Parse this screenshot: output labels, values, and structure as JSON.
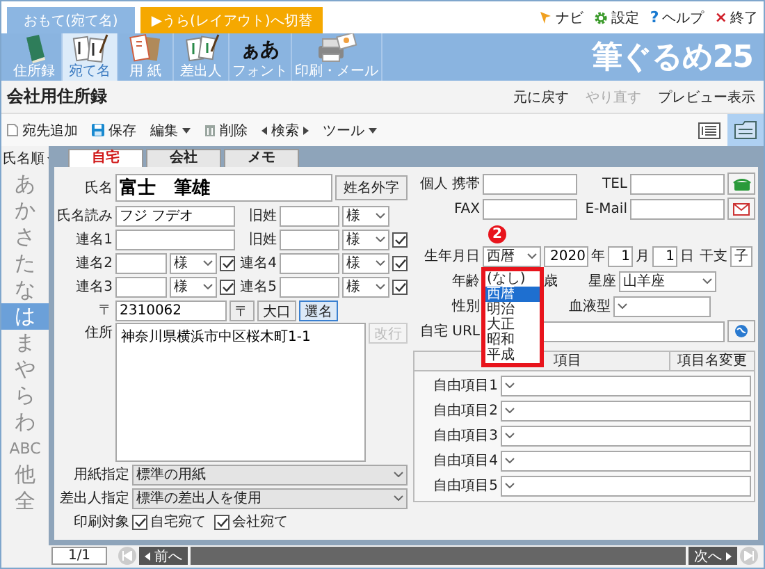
{
  "top_tabs": [
    {
      "label": "おもて(宛て名)",
      "selected": true
    },
    {
      "label": "▶うら(レイアウト)へ切替",
      "selected": false
    }
  ],
  "top_links": [
    {
      "kind": "navi",
      "label": "ナビ"
    },
    {
      "kind": "settings",
      "label": "設定"
    },
    {
      "kind": "help",
      "label": "ヘルプ",
      "glyph": "?"
    },
    {
      "kind": "exit",
      "label": "終了",
      "glyph": "×"
    }
  ],
  "tools": [
    {
      "kind": "book",
      "label": "住所録",
      "selected": false
    },
    {
      "kind": "cards",
      "label": "宛て名",
      "selected": true
    },
    {
      "kind": "paper",
      "label": "用 紙",
      "selected": false
    },
    {
      "kind": "sender",
      "label": "差出人",
      "selected": false
    },
    {
      "kind": "font",
      "label": "フォント",
      "glyph": "ぁあ",
      "selected": false
    },
    {
      "kind": "print",
      "label": "印刷・メール",
      "selected": false
    }
  ],
  "logo": "筆ぐるめ25",
  "title": "会社用住所録",
  "title_actions": [
    {
      "label": "元に戻す",
      "disabled": false
    },
    {
      "label": "やり直す",
      "disabled": true
    },
    {
      "label": "プレビュー表示",
      "disabled": false
    }
  ],
  "commands": [
    {
      "kind": "add",
      "label": "宛先追加"
    },
    {
      "kind": "save",
      "label": "保存"
    },
    {
      "kind": "menu",
      "label": "編集"
    },
    {
      "kind": "delete",
      "label": "削除"
    },
    {
      "kind": "search",
      "label": "検索"
    },
    {
      "kind": "menu",
      "label": "ツール"
    }
  ],
  "view_buttons": [
    {
      "kind": "list",
      "selected": false
    },
    {
      "kind": "card",
      "selected": true
    }
  ],
  "index": {
    "sort": "氏名順",
    "items": [
      {
        "label": "あ",
        "selected": false
      },
      {
        "label": "か",
        "selected": false
      },
      {
        "label": "さ",
        "selected": false
      },
      {
        "label": "た",
        "selected": false
      },
      {
        "label": "な",
        "selected": false
      },
      {
        "label": "は",
        "selected": true
      },
      {
        "label": "ま",
        "selected": false
      },
      {
        "label": "や",
        "selected": false
      },
      {
        "label": "ら",
        "selected": false
      },
      {
        "label": "わ",
        "selected": false
      },
      {
        "label": "ABC",
        "selected": false
      },
      {
        "label": "他",
        "selected": false
      },
      {
        "label": "全",
        "selected": false
      }
    ]
  },
  "record_tabs": [
    {
      "label": "自宅",
      "selected": true
    },
    {
      "label": "会社",
      "selected": false
    },
    {
      "label": "メモ",
      "selected": false
    }
  ],
  "name": {
    "label": "氏名",
    "value": "富士　筆雄",
    "button": "姓名外字"
  },
  "name_rows": [
    {
      "left": {
        "label": "氏名読み",
        "value": "フジ フデオ"
      },
      "right": {
        "label": "旧姓",
        "title": "様"
      }
    },
    {
      "left": {
        "label": "連名1"
      },
      "right": {
        "label": "旧姓",
        "title": "様",
        "checked": true
      }
    },
    {
      "left": {
        "label": "連名2",
        "title": "様",
        "checked": true
      },
      "right": {
        "label": "連名4",
        "title": "様",
        "checked": true
      }
    },
    {
      "left": {
        "label": "連名3",
        "title": "様",
        "checked": true
      },
      "right": {
        "label": "連名5",
        "title": "様",
        "checked": true
      }
    }
  ],
  "postal": {
    "label": "〒",
    "value": "2310062",
    "buttons": [
      {
        "label": "〒",
        "focused": false
      },
      {
        "label": "大口",
        "focused": false
      },
      {
        "label": "選名",
        "focused": true
      }
    ]
  },
  "address": {
    "label": "住所",
    "value": "神奈川県横浜市中区桜木町1-1",
    "button": "改行",
    "button_disabled": true
  },
  "print_settings": [
    {
      "label": "用紙指定",
      "value": "標準の用紙"
    },
    {
      "label": "差出人指定",
      "value": "標準の差出人を使用"
    }
  ],
  "print_target": {
    "label": "印刷対象",
    "options": [
      {
        "label": "自宅宛て",
        "checked": true
      },
      {
        "label": "会社宛て",
        "checked": true
      }
    ]
  },
  "contacts": [
    {
      "label": "個人 携帯",
      "right_label": "TEL",
      "kind": "phone"
    },
    {
      "label": "FAX",
      "right_label": "E-Mail",
      "kind": "mail"
    }
  ],
  "birth": {
    "label": "生年月日",
    "era": "西暦",
    "year": "2020",
    "year_unit": "年",
    "month": "1",
    "month_unit": "月",
    "day": "1",
    "day_unit": "日",
    "eto_label": "干支",
    "eto": "子"
  },
  "age": {
    "label": "年齢",
    "unit": "歳",
    "sign_label": "星座",
    "sign": "山羊座"
  },
  "gender": {
    "label": "性別",
    "blood_label": "血液型"
  },
  "url": {
    "label": "自宅 URL"
  },
  "free_items": {
    "columns": [
      "項目",
      "項目名変更"
    ],
    "rows": [
      {
        "label": "自由項目1"
      },
      {
        "label": "自由項目2"
      },
      {
        "label": "自由項目3"
      },
      {
        "label": "自由項目4"
      },
      {
        "label": "自由項目5"
      }
    ]
  },
  "era_dropdown": {
    "badge": "2",
    "options": [
      {
        "label": "(なし)",
        "selected": false
      },
      {
        "label": "西暦",
        "selected": true
      },
      {
        "label": "明治",
        "selected": false
      },
      {
        "label": "大正",
        "selected": false
      },
      {
        "label": "昭和",
        "selected": false
      },
      {
        "label": "平成",
        "selected": false
      }
    ]
  },
  "pager": {
    "value": "1/1",
    "prev": "前へ",
    "next": "次へ"
  }
}
